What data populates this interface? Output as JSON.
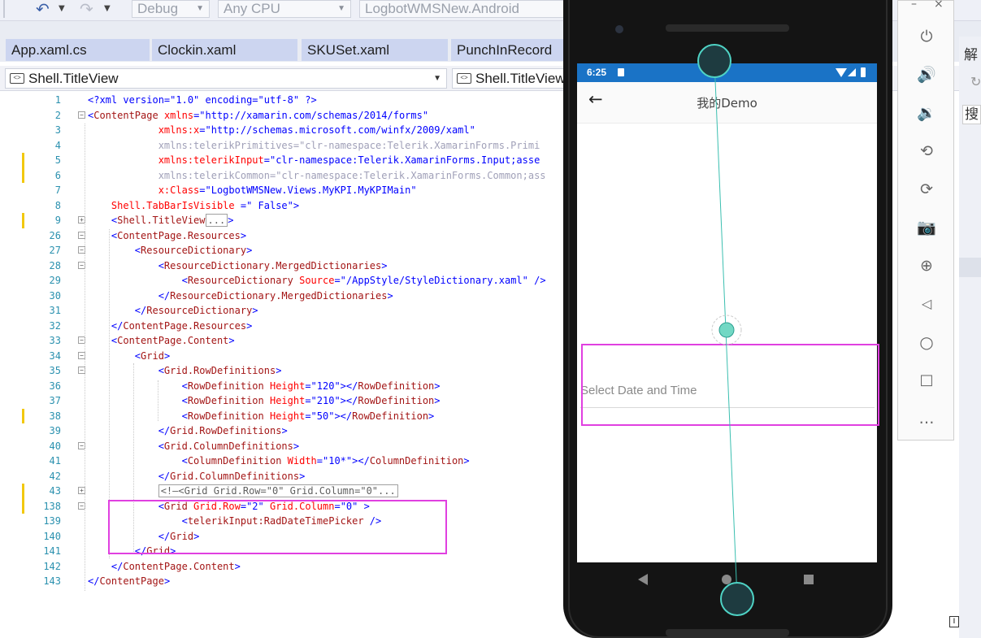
{
  "toolbar": {
    "undo_icon": "undo-icon",
    "redo_icon": "redo-icon",
    "config": "Debug",
    "platform": "Any CPU",
    "startup_project": "LogbotWMSNew.Android"
  },
  "tabs": [
    "App.xaml.cs",
    "Clockin.xaml",
    "SKUSet.xaml",
    "PunchInRecord"
  ],
  "navbar": {
    "left_scope": "Shell.TitleView",
    "right_scope": "Shell.TitleView"
  },
  "right_pane": {
    "char1": "解",
    "char2": "搜"
  },
  "code_lines": [
    {
      "n": "1",
      "parts": [
        [
          "b",
          "<?xml version=\"1.0\" encoding=\"utf-8\" ?>"
        ]
      ]
    },
    {
      "n": "2",
      "fold": "−",
      "parts": [
        [
          "b",
          "<"
        ],
        [
          "t",
          "ContentPage"
        ],
        [
          "a",
          " xmlns"
        ],
        [
          "b",
          "=\"http://xamarin.com/schemas/2014/forms\""
        ]
      ]
    },
    {
      "n": "3",
      "parts": [
        [
          "a",
          "            xmlns:x"
        ],
        [
          "b",
          "=\"http://schemas.microsoft.com/winfx/2009/xaml\""
        ]
      ]
    },
    {
      "n": "4",
      "parts": [
        [
          "g",
          "            xmlns:telerikPrimitives=\"clr-namespace:Telerik.XamarinForms.Primi"
        ]
      ]
    },
    {
      "n": "5",
      "chg": true,
      "parts": [
        [
          "a",
          "            xmlns:telerikInput"
        ],
        [
          "b",
          "=\"clr-namespace:Telerik.XamarinForms.Input;asse"
        ]
      ]
    },
    {
      "n": "6",
      "chg": true,
      "parts": [
        [
          "g",
          "            xmlns:telerikCommon=\"clr-namespace:Telerik.XamarinForms.Common;ass"
        ]
      ]
    },
    {
      "n": "7",
      "parts": [
        [
          "a",
          "            x:Class"
        ],
        [
          "b",
          "=\"LogbotWMSNew.Views.MyKPI.MyKPIMain\""
        ]
      ]
    },
    {
      "n": "8",
      "parts": [
        [
          "a",
          "    Shell.TabBarIsVisible "
        ],
        [
          "b",
          "=\" False\">"
        ]
      ]
    },
    {
      "n": "9",
      "chg": true,
      "fold": "+",
      "parts": [
        [
          "b",
          "    <"
        ],
        [
          "t",
          "Shell.TitleView"
        ],
        [
          "box",
          "..."
        ],
        [
          "b",
          ">"
        ]
      ]
    },
    {
      "n": "26",
      "fold": "−",
      "parts": [
        [
          "b",
          "    <"
        ],
        [
          "t",
          "ContentPage.Resources"
        ],
        [
          "b",
          ">"
        ]
      ]
    },
    {
      "n": "27",
      "fold": "−",
      "parts": [
        [
          "b",
          "        <"
        ],
        [
          "t",
          "ResourceDictionary"
        ],
        [
          "b",
          ">"
        ]
      ]
    },
    {
      "n": "28",
      "fold": "−",
      "parts": [
        [
          "b",
          "            <"
        ],
        [
          "t",
          "ResourceDictionary.MergedDictionaries"
        ],
        [
          "b",
          ">"
        ]
      ]
    },
    {
      "n": "29",
      "parts": [
        [
          "b",
          "                <"
        ],
        [
          "t",
          "ResourceDictionary"
        ],
        [
          "a",
          " Source"
        ],
        [
          "b",
          "=\"/AppStyle/StyleDictionary.xaml\" />"
        ]
      ]
    },
    {
      "n": "30",
      "parts": [
        [
          "b",
          "            </"
        ],
        [
          "t",
          "ResourceDictionary.MergedDictionaries"
        ],
        [
          "b",
          ">"
        ]
      ]
    },
    {
      "n": "31",
      "parts": [
        [
          "b",
          "        </"
        ],
        [
          "t",
          "ResourceDictionary"
        ],
        [
          "b",
          ">"
        ]
      ]
    },
    {
      "n": "32",
      "parts": [
        [
          "b",
          "    </"
        ],
        [
          "t",
          "ContentPage.Resources"
        ],
        [
          "b",
          ">"
        ]
      ]
    },
    {
      "n": "33",
      "fold": "−",
      "parts": [
        [
          "b",
          "    <"
        ],
        [
          "t",
          "ContentPage.Content"
        ],
        [
          "b",
          ">"
        ]
      ]
    },
    {
      "n": "34",
      "fold": "−",
      "parts": [
        [
          "b",
          "        <"
        ],
        [
          "t",
          "Grid"
        ],
        [
          "b",
          ">"
        ]
      ]
    },
    {
      "n": "35",
      "fold": "−",
      "parts": [
        [
          "b",
          "            <"
        ],
        [
          "t",
          "Grid.RowDefinitions"
        ],
        [
          "b",
          ">"
        ]
      ]
    },
    {
      "n": "36",
      "parts": [
        [
          "b",
          "                <"
        ],
        [
          "t",
          "RowDefinition"
        ],
        [
          "a",
          " Height"
        ],
        [
          "b",
          "=\"120\"></"
        ],
        [
          "t",
          "RowDefinition"
        ],
        [
          "b",
          ">"
        ]
      ]
    },
    {
      "n": "37",
      "parts": [
        [
          "b",
          "                <"
        ],
        [
          "t",
          "RowDefinition"
        ],
        [
          "a",
          " Height"
        ],
        [
          "b",
          "=\"210\"></"
        ],
        [
          "t",
          "RowDefinition"
        ],
        [
          "b",
          ">"
        ]
      ]
    },
    {
      "n": "38",
      "chg": true,
      "parts": [
        [
          "b",
          "                <"
        ],
        [
          "t",
          "RowDefinition"
        ],
        [
          "a",
          " Height"
        ],
        [
          "b",
          "=\"50\"></"
        ],
        [
          "t",
          "RowDefinition"
        ],
        [
          "b",
          ">"
        ]
      ]
    },
    {
      "n": "39",
      "parts": [
        [
          "b",
          "            </"
        ],
        [
          "t",
          "Grid.RowDefinitions"
        ],
        [
          "b",
          ">"
        ]
      ]
    },
    {
      "n": "40",
      "fold": "−",
      "parts": [
        [
          "b",
          "            <"
        ],
        [
          "t",
          "Grid.ColumnDefinitions"
        ],
        [
          "b",
          ">"
        ]
      ]
    },
    {
      "n": "41",
      "parts": [
        [
          "b",
          "                <"
        ],
        [
          "t",
          "ColumnDefinition"
        ],
        [
          "a",
          " Width"
        ],
        [
          "b",
          "=\"10*\"></"
        ],
        [
          "t",
          "ColumnDefinition"
        ],
        [
          "b",
          ">"
        ]
      ]
    },
    {
      "n": "42",
      "parts": [
        [
          "b",
          "            </"
        ],
        [
          "t",
          "Grid.ColumnDefinitions"
        ],
        [
          "b",
          ">"
        ]
      ]
    },
    {
      "n": "43",
      "chg": true,
      "fold": "+",
      "parts": [
        [
          "b",
          "            "
        ],
        [
          "box",
          "<!—<Grid Grid.Row=\"0\" Grid.Column=\"0\"..."
        ]
      ]
    },
    {
      "n": "138",
      "chg": true,
      "fold": "−",
      "parts": [
        [
          "b",
          "            <"
        ],
        [
          "t",
          "Grid"
        ],
        [
          "a",
          " Grid.Row"
        ],
        [
          "b",
          "=\"2\""
        ],
        [
          "a",
          " Grid.Column"
        ],
        [
          "b",
          "=\"0\" >"
        ]
      ]
    },
    {
      "n": "139",
      "parts": [
        [
          "b",
          "                <"
        ],
        [
          "t",
          "telerikInput:RadDateTimePicker"
        ],
        [
          "b",
          " />"
        ]
      ]
    },
    {
      "n": "140",
      "parts": [
        [
          "b",
          "            </"
        ],
        [
          "t",
          "Grid"
        ],
        [
          "b",
          ">"
        ]
      ]
    },
    {
      "n": "141",
      "parts": [
        [
          "b",
          "        </"
        ],
        [
          "t",
          "Grid"
        ],
        [
          "b",
          ">"
        ]
      ]
    },
    {
      "n": "142",
      "parts": [
        [
          "b",
          "    </"
        ],
        [
          "t",
          "ContentPage.Content"
        ],
        [
          "b",
          ">"
        ]
      ]
    },
    {
      "n": "143",
      "parts": [
        [
          "b",
          "</"
        ],
        [
          "t",
          "ContentPage"
        ],
        [
          "b",
          ">"
        ]
      ]
    }
  ],
  "phone": {
    "time": "6:25",
    "title": "我的Demo",
    "back_icon": "arrow-back-icon",
    "picker_placeholder": "Select Date and Time",
    "nav_buttons": [
      "back-triangle-icon",
      "home-circle-icon",
      "recents-square-icon"
    ]
  },
  "emulator_controls": [
    "power-icon",
    "volume-up-icon",
    "volume-down-icon",
    "rotate-left-icon",
    "rotate-right-icon",
    "camera-icon",
    "zoom-icon",
    "back-icon",
    "home-icon",
    "overview-icon",
    "more-icon"
  ],
  "colors": {
    "highlight": "#e040e0",
    "status_bar": "#1a73c6",
    "tab_bg": "#ccd5f0"
  }
}
